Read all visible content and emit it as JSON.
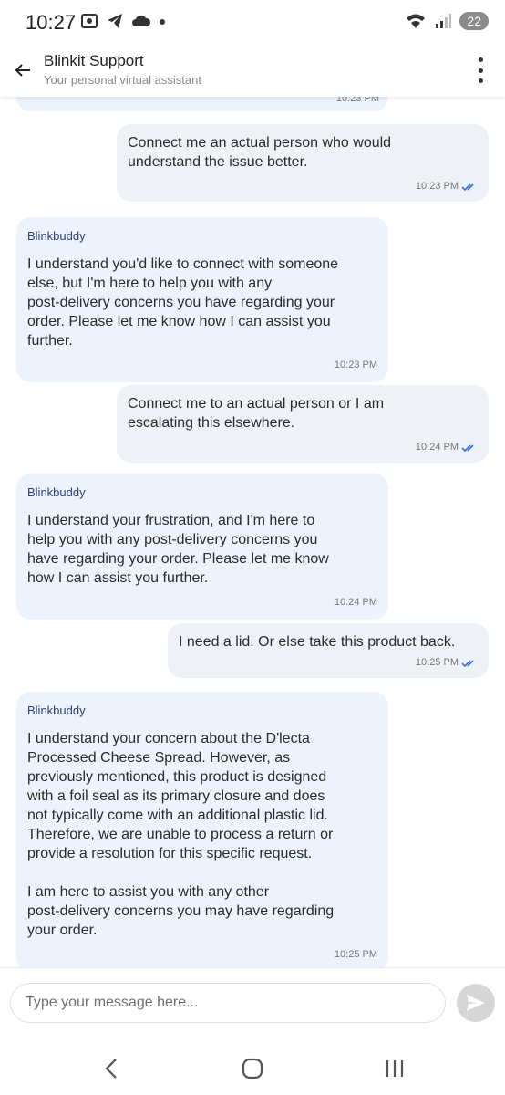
{
  "status_bar": {
    "time": "10:27",
    "battery": "22"
  },
  "header": {
    "title": "Blinkit Support",
    "subtitle": "Your personal virtual assistant"
  },
  "chat": {
    "partial_top_time": "10:23 PM",
    "messages": [
      {
        "from": "user",
        "text": "Connect me an actual person who would\nunderstand the issue better.",
        "time": "10:23 PM"
      },
      {
        "from": "bot",
        "sender": "Blinkbuddy",
        "text": "I understand you'd like to connect with someone\nelse, but I'm here to help you with any\npost-delivery concerns you have regarding your\norder. Please let me know how I can assist you\nfurther.",
        "time": "10:23 PM"
      },
      {
        "from": "user",
        "text": "Connect me to an actual person or I am\nescalating this elsewhere.",
        "time": "10:24 PM"
      },
      {
        "from": "bot",
        "sender": "Blinkbuddy",
        "text": "I understand your frustration, and I'm here to\nhelp you with any post-delivery concerns you\nhave regarding your order. Please let me know\nhow I can assist you further.",
        "time": "10:24 PM"
      },
      {
        "from": "user",
        "text": "I need a lid. Or else take this product back.",
        "time": "10:25 PM"
      },
      {
        "from": "bot",
        "sender": "Blinkbuddy",
        "text": "I understand your concern about the D'lecta\nProcessed Cheese Spread. However, as\npreviously mentioned, this product is designed\nwith a foil seal as its primary closure and does\nnot typically come with an additional plastic lid.\nTherefore, we are unable to process a return or\nprovide a resolution for this specific request.\n\nI am here to assist you with any other\npost-delivery concerns you may have regarding\nyour order.",
        "time": "10:25 PM"
      }
    ]
  },
  "input": {
    "placeholder": "Type your message here...",
    "value": ""
  },
  "colors": {
    "bot_bubble": "#edf3fc",
    "user_bubble": "#eef1f6",
    "tick_blue": "#3a6fd8",
    "sender_name": "#2c3e7a"
  }
}
